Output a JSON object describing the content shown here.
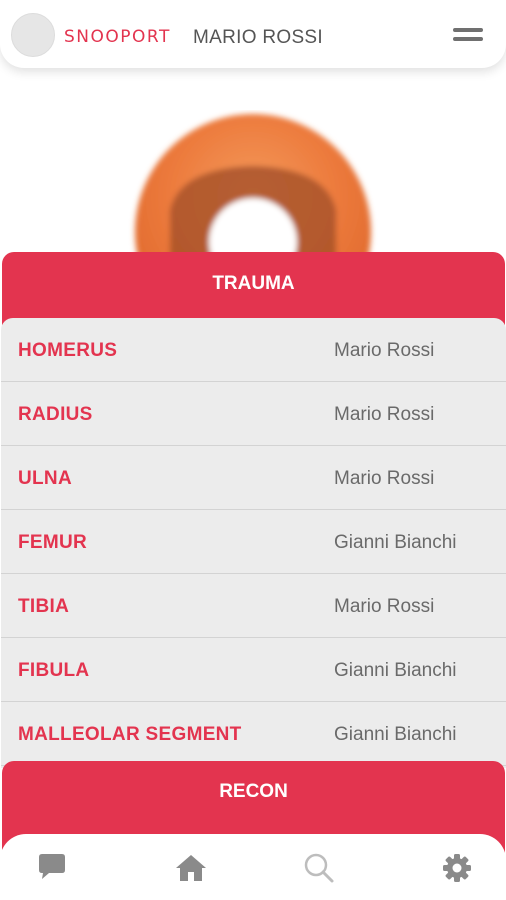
{
  "header": {
    "brand": "SNOOPORT",
    "user_name": "MARIO ROSSI",
    "menu_icon": "hamburger-menu-icon"
  },
  "colors": {
    "accent": "#e3344f",
    "list_bg": "#ececec",
    "hero_orange": "#ef7a3a",
    "icon_gray": "#8a8a8a"
  },
  "sections": {
    "trauma": {
      "title": "TRAUMA",
      "items": [
        {
          "name": "HOMERUS",
          "person": "Mario Rossi"
        },
        {
          "name": "RADIUS",
          "person": "Mario Rossi"
        },
        {
          "name": "ULNA",
          "person": "Mario Rossi"
        },
        {
          "name": "FEMUR",
          "person": "Gianni Bianchi"
        },
        {
          "name": "TIBIA",
          "person": "Mario Rossi"
        },
        {
          "name": "FIBULA",
          "person": "Gianni Bianchi"
        },
        {
          "name": "MALLEOLAR SEGMENT",
          "person": "Gianni Bianchi"
        }
      ]
    },
    "recon": {
      "title": "RECON"
    }
  },
  "bottom_nav": [
    {
      "icon": "chat-icon"
    },
    {
      "icon": "home-icon"
    },
    {
      "icon": "search-icon"
    },
    {
      "icon": "gear-icon"
    }
  ]
}
